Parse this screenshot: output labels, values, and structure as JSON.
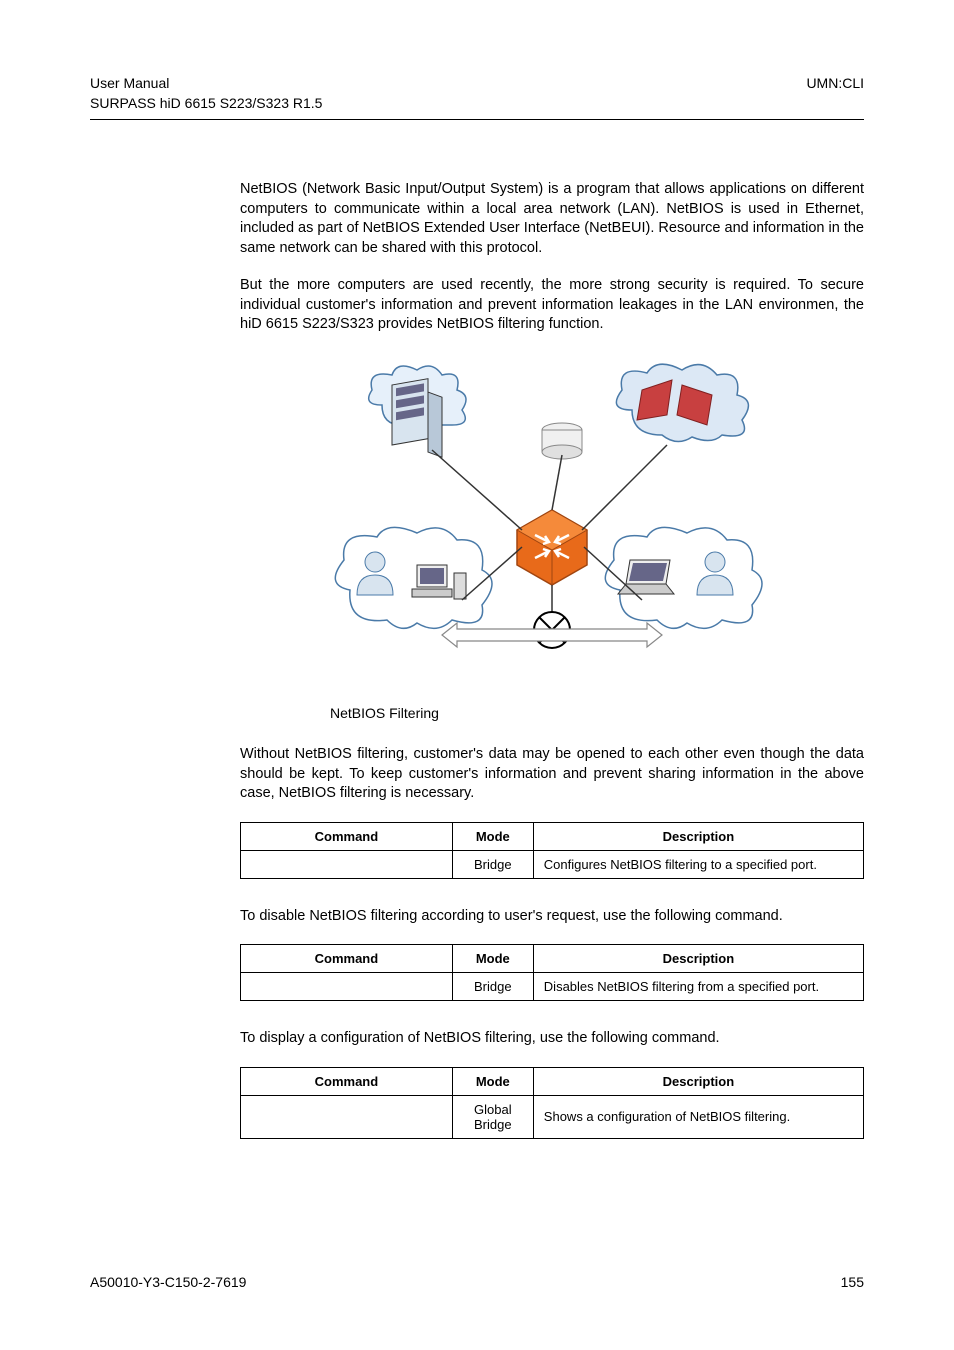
{
  "header": {
    "left1": "User  Manual",
    "right1": "UMN:CLI",
    "left2": "SURPASS hiD 6615 S223/S323 R1.5"
  },
  "paragraphs": {
    "p1": "NetBIOS (Network Basic Input/Output System) is a program that allows applications on different computers to communicate within a local area network (LAN). NetBIOS is used in Ethernet, included as part of NetBIOS Extended User Interface (NetBEUI). Resource and information in the same network can be shared with this protocol.",
    "p2": "But the more computers are used recently, the more strong security is required. To secure individual customer's information and prevent information leakages in the LAN environmen, the hiD 6615 S223/S323 provides NetBIOS filtering function.",
    "figcap": "NetBIOS Filtering",
    "p3": "Without NetBIOS filtering, customer's data may be opened to each other even though the data should be kept. To keep customer's information and prevent sharing information in the above case, NetBIOS filtering is necessary.",
    "p4": "To disable NetBIOS filtering according to user's request, use the following command.",
    "p5": "To display a configuration of NetBIOS filtering, use the following command."
  },
  "tables": {
    "t1": {
      "headers": [
        "Command",
        "Mode",
        "Description"
      ],
      "rows": [
        {
          "cmd": "",
          "mode": "Bridge",
          "desc": "Configures NetBIOS filtering to a specified port."
        }
      ]
    },
    "t2": {
      "headers": [
        "Command",
        "Mode",
        "Description"
      ],
      "rows": [
        {
          "cmd": "",
          "mode": "Bridge",
          "desc": "Disables NetBIOS filtering from a specified port."
        }
      ]
    },
    "t3": {
      "headers": [
        "Command",
        "Mode",
        "Description"
      ],
      "rows": [
        {
          "cmd": "",
          "mode": "Global\nBridge",
          "desc": "Shows a configuration of NetBIOS filtering."
        }
      ]
    }
  },
  "footer": {
    "left": "A50010-Y3-C150-2-7619",
    "right": "155"
  }
}
